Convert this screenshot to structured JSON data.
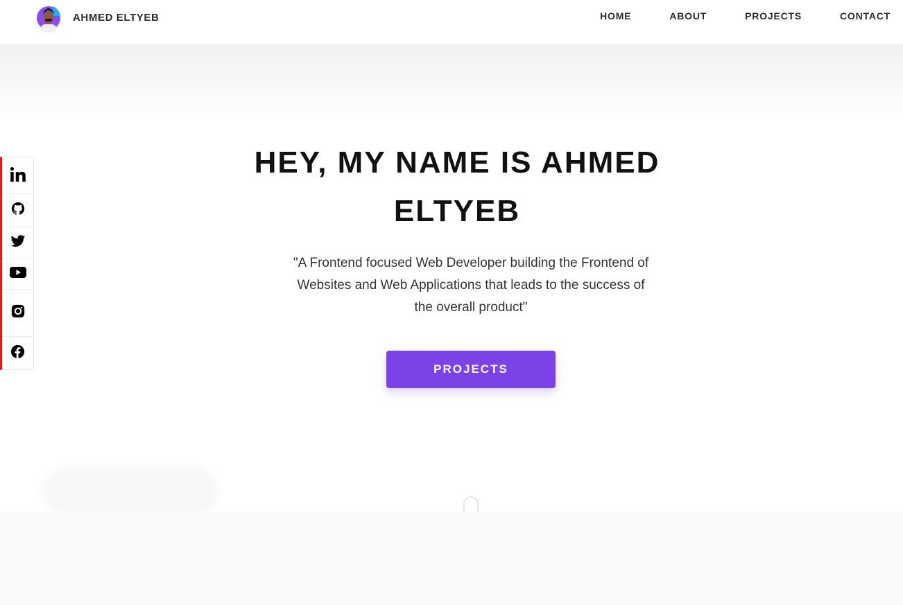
{
  "header": {
    "brand_name": "AHMED ELTYEB",
    "nav": [
      {
        "label": "HOME"
      },
      {
        "label": "ABOUT"
      },
      {
        "label": "PROJECTS"
      },
      {
        "label": "CONTACT"
      }
    ]
  },
  "hero": {
    "title": "HEY, MY NAME IS AHMED ELTYEB",
    "subtitle": "\"A Frontend focused Web Developer building the Frontend of Websites and Web Applications that leads to the success of the overall product\"",
    "cta_label": "PROJECTS"
  },
  "social": {
    "icons": [
      "linkedin-icon",
      "github-icon",
      "twitter-icon",
      "youtube-icon",
      "instagram-icon",
      "facebook-icon"
    ],
    "accent_color": "#e31b23"
  },
  "colors": {
    "accent": "#7b42e8",
    "text": "#111111"
  }
}
